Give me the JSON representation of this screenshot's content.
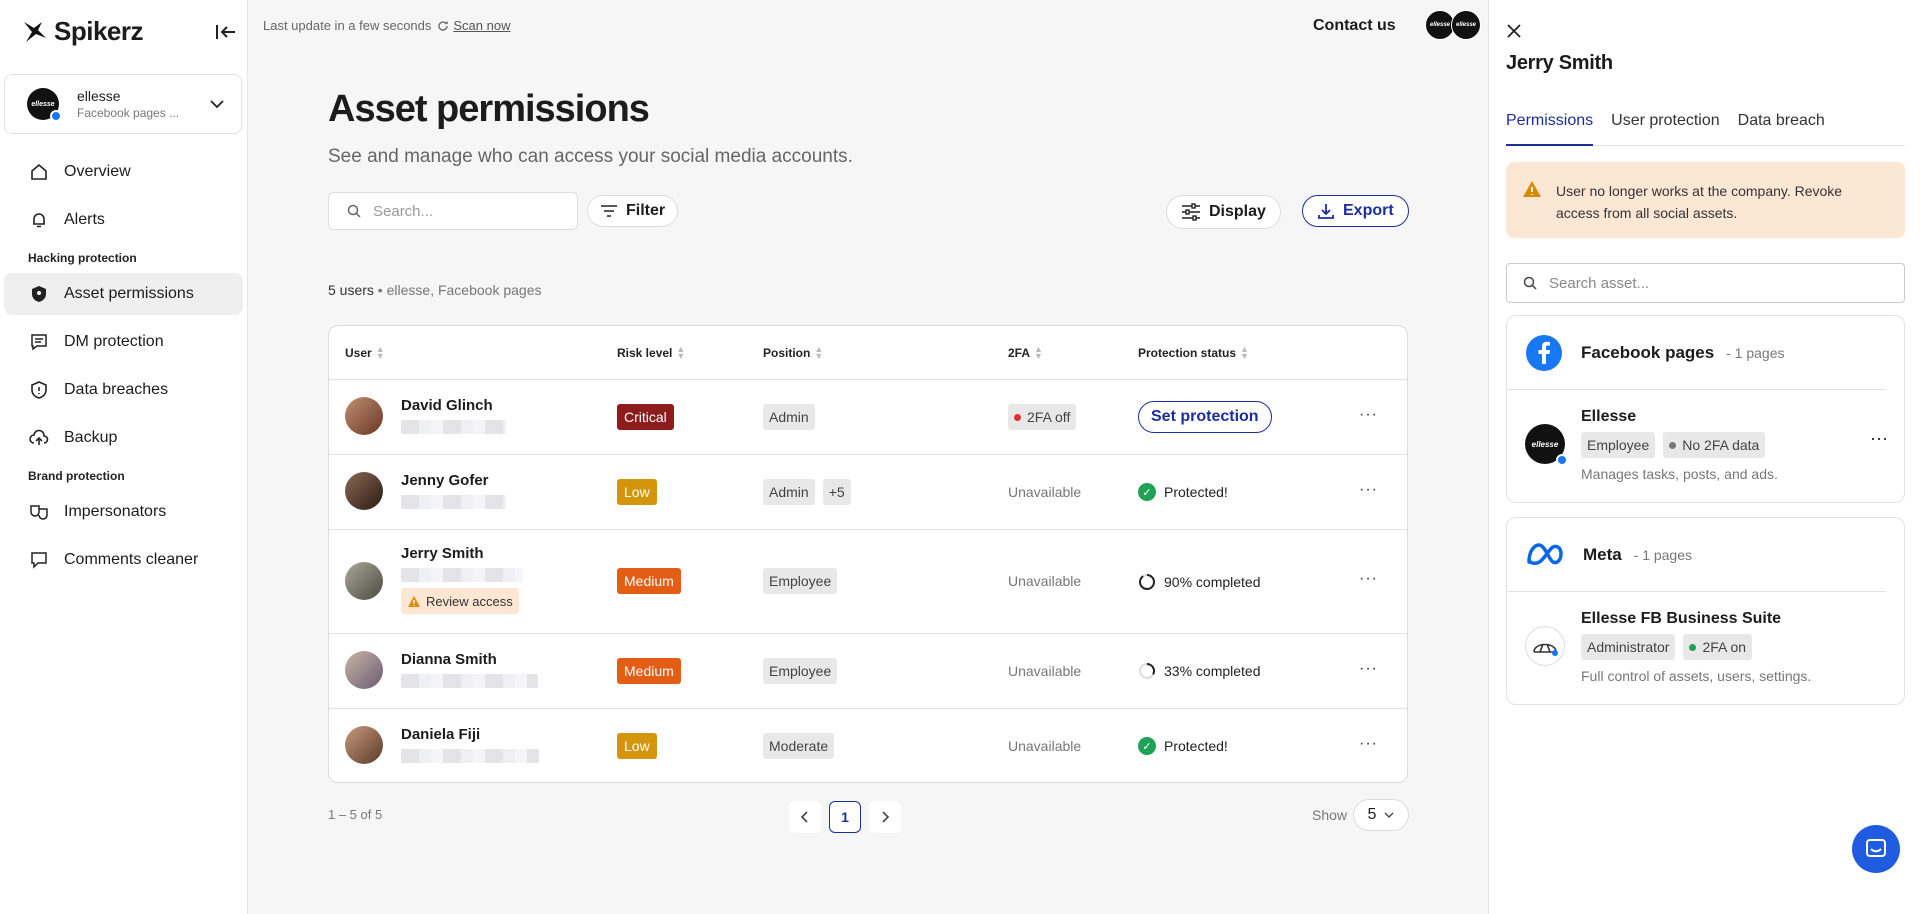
{
  "app": {
    "name": "Spikerz"
  },
  "account": {
    "name": "ellesse",
    "sub": "Facebook pages ..."
  },
  "nav": {
    "overview": "Overview",
    "alerts": "Alerts",
    "section_hacking": "Hacking protection",
    "asset_permissions": "Asset permissions",
    "dm_protection": "DM protection",
    "data_breaches": "Data breaches",
    "backup": "Backup",
    "section_brand": "Brand protection",
    "impersonators": "Impersonators",
    "comments_cleaner": "Comments cleaner"
  },
  "topbar": {
    "last_update": "Last update in a few seconds",
    "scan_now": "Scan now",
    "contact": "Contact us"
  },
  "page": {
    "title": "Asset permissions",
    "subtitle": "See and manage who can access your social media accounts.",
    "search_placeholder": "Search...",
    "filter": "Filter",
    "display": "Display",
    "export": "Export",
    "summary_count": "5 users",
    "summary_rest": "ellesse, Facebook pages"
  },
  "table": {
    "headers": {
      "user": "User",
      "risk": "Risk level",
      "position": "Position",
      "twofa": "2FA",
      "protection": "Protection status"
    },
    "rows": [
      {
        "name": "David Glinch",
        "risk": "Critical",
        "risk_color": "#8e1c1c",
        "position": "Admin",
        "twofa": "2FA off",
        "action": "Set protection"
      },
      {
        "name": "Jenny Gofer",
        "risk": "Low",
        "risk_color": "#d4940b",
        "position": "Admin",
        "position_extra": "+5",
        "twofa": "Unavailable",
        "status": "Protected!"
      },
      {
        "name": "Jerry Smith",
        "risk": "Medium",
        "risk_color": "#e35d14",
        "position": "Employee",
        "twofa": "Unavailable",
        "status": "90% completed",
        "review": "Review access"
      },
      {
        "name": "Dianna Smith",
        "risk": "Medium",
        "risk_color": "#e35d14",
        "position": "Employee",
        "twofa": "Unavailable",
        "status": "33% completed"
      },
      {
        "name": "Daniela Fiji",
        "risk": "Low",
        "risk_color": "#d4940b",
        "position": "Moderate",
        "twofa": "Unavailable",
        "status": "Protected!"
      }
    ]
  },
  "pager": {
    "range": "1 – 5 of 5",
    "current_page": "1",
    "show_label": "Show",
    "show_value": "5"
  },
  "panel": {
    "title": "Jerry Smith",
    "tabs": [
      "Permissions",
      "User protection",
      "Data breach"
    ],
    "warning": "User no longer works at the company. Revoke access from all social assets.",
    "search_placeholder": "Search asset...",
    "groups": [
      {
        "title": "Facebook pages",
        "count": "1 pages",
        "asset": "Ellesse",
        "tag1": "Employee",
        "tag2": "No 2FA data",
        "desc": "Manages tasks, posts, and ads."
      },
      {
        "title": "Meta",
        "count": "1 pages",
        "asset": "Ellesse FB Business Suite",
        "tag1": "Administrator",
        "tag2": "2FA on",
        "desc": "Full control of assets, users, settings."
      }
    ]
  },
  "colors": {
    "accent": "#1c2e9c",
    "warning_bg": "#fce7d4",
    "success": "#1fa255",
    "danger": "#8e1c1c"
  }
}
